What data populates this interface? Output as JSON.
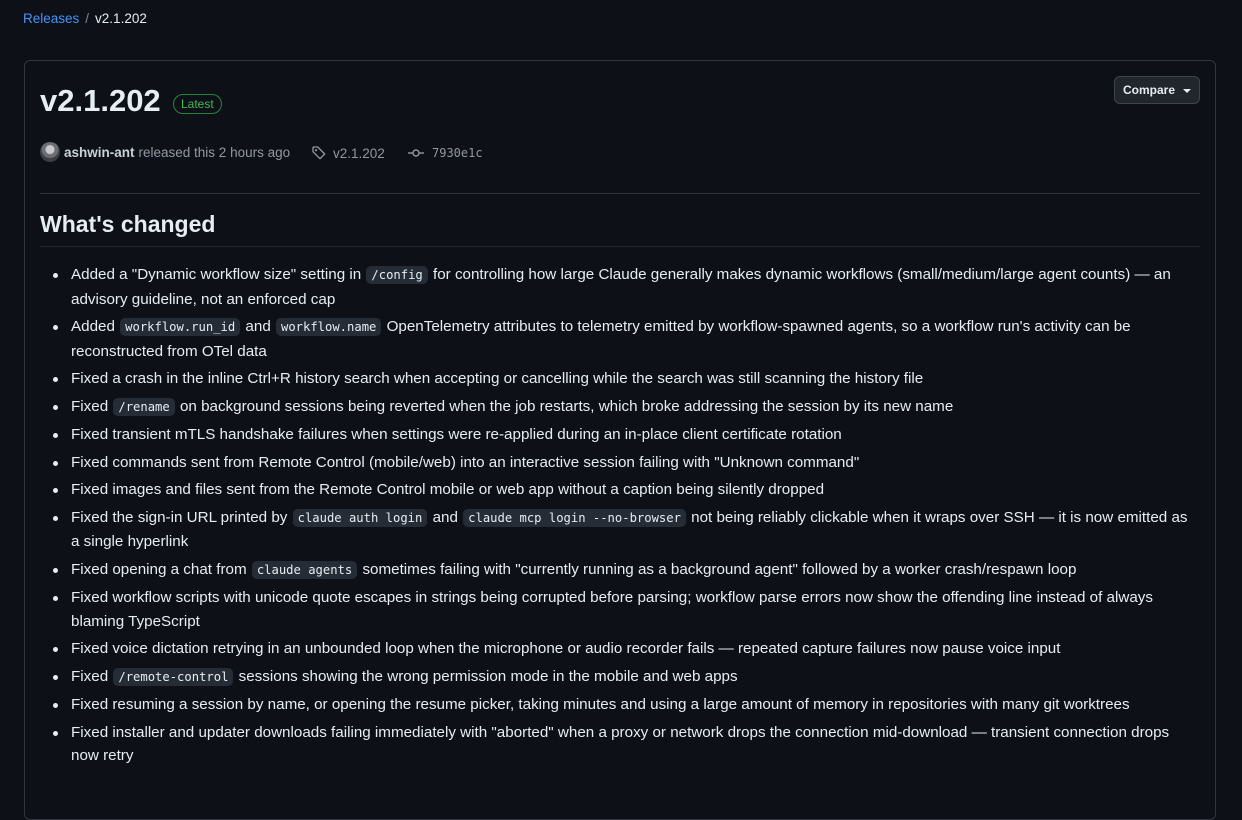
{
  "breadcrumb": {
    "parent": "Releases",
    "separator": "/",
    "current": "v2.1.202"
  },
  "release": {
    "title": "v2.1.202",
    "badge": "Latest",
    "compare_label": "Compare",
    "author": "ashwin-ant",
    "released_text": "released this 2 hours ago",
    "tag": "v2.1.202",
    "commit": "7930e1c"
  },
  "section_heading": "What's changed",
  "changes": [
    {
      "parts": [
        {
          "t": "text",
          "v": "Added a \"Dynamic workflow size\" setting in "
        },
        {
          "t": "code",
          "v": "/config"
        },
        {
          "t": "text",
          "v": " for controlling how large Claude generally makes dynamic workflows (small/medium/large agent counts) — an advisory guideline, not an enforced cap"
        }
      ]
    },
    {
      "parts": [
        {
          "t": "text",
          "v": "Added "
        },
        {
          "t": "code",
          "v": "workflow.run_id"
        },
        {
          "t": "text",
          "v": " and "
        },
        {
          "t": "code",
          "v": "workflow.name"
        },
        {
          "t": "text",
          "v": " OpenTelemetry attributes to telemetry emitted by workflow-spawned agents, so a workflow run's activity can be reconstructed from OTel data"
        }
      ]
    },
    {
      "parts": [
        {
          "t": "text",
          "v": "Fixed a crash in the inline Ctrl+R history search when accepting or cancelling while the search was still scanning the history file"
        }
      ]
    },
    {
      "parts": [
        {
          "t": "text",
          "v": "Fixed "
        },
        {
          "t": "code",
          "v": "/rename"
        },
        {
          "t": "text",
          "v": " on background sessions being reverted when the job restarts, which broke addressing the session by its new name"
        }
      ]
    },
    {
      "parts": [
        {
          "t": "text",
          "v": "Fixed transient mTLS handshake failures when settings were re-applied during an in-place client certificate rotation"
        }
      ]
    },
    {
      "parts": [
        {
          "t": "text",
          "v": "Fixed commands sent from Remote Control (mobile/web) into an interactive session failing with \"Unknown command\""
        }
      ]
    },
    {
      "parts": [
        {
          "t": "text",
          "v": "Fixed images and files sent from the Remote Control mobile or web app without a caption being silently dropped"
        }
      ]
    },
    {
      "parts": [
        {
          "t": "text",
          "v": "Fixed the sign-in URL printed by "
        },
        {
          "t": "code",
          "v": "claude auth login"
        },
        {
          "t": "text",
          "v": " and "
        },
        {
          "t": "code",
          "v": "claude mcp login --no-browser"
        },
        {
          "t": "text",
          "v": " not being reliably clickable when it wraps over SSH — it is now emitted as a single hyperlink"
        }
      ]
    },
    {
      "parts": [
        {
          "t": "text",
          "v": "Fixed opening a chat from "
        },
        {
          "t": "code",
          "v": "claude agents"
        },
        {
          "t": "text",
          "v": " sometimes failing with \"currently running as a background agent\" followed by a worker crash/respawn loop"
        }
      ]
    },
    {
      "parts": [
        {
          "t": "text",
          "v": "Fixed workflow scripts with unicode quote escapes in strings being corrupted before parsing; workflow parse errors now show the offending line instead of always blaming TypeScript"
        }
      ]
    },
    {
      "parts": [
        {
          "t": "text",
          "v": "Fixed voice dictation retrying in an unbounded loop when the microphone or audio recorder fails — repeated capture failures now pause voice input"
        }
      ]
    },
    {
      "parts": [
        {
          "t": "text",
          "v": "Fixed "
        },
        {
          "t": "code",
          "v": "/remote-control"
        },
        {
          "t": "text",
          "v": " sessions showing the wrong permission mode in the mobile and web apps"
        }
      ]
    },
    {
      "parts": [
        {
          "t": "text",
          "v": "Fixed resuming a session by name, or opening the resume picker, taking minutes and using a large amount of memory in repositories with many git worktrees"
        }
      ]
    },
    {
      "parts": [
        {
          "t": "text",
          "v": "Fixed installer and updater downloads failing immediately with \"aborted\" when a proxy or network drops the connection mid-download — transient connection drops now retry"
        }
      ]
    }
  ]
}
